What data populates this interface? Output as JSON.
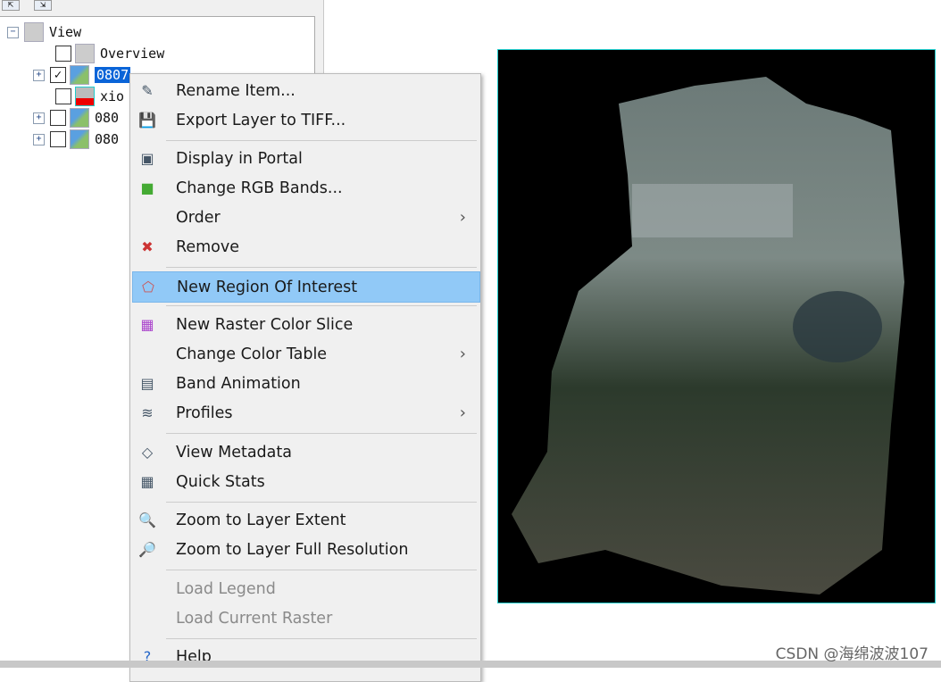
{
  "tree": {
    "root": "View",
    "nodes": [
      {
        "label": "Overview",
        "checked": false,
        "icon": "eye-monitor-icon"
      },
      {
        "label": "0807",
        "checked": true,
        "icon": "raster-icon",
        "selected": true
      },
      {
        "label": "xio",
        "checked": false,
        "icon": "roi-layer-icon"
      },
      {
        "label": "080",
        "checked": false,
        "icon": "raster-icon"
      },
      {
        "label": "080",
        "checked": false,
        "icon": "raster-icon"
      }
    ]
  },
  "menu": {
    "items": [
      {
        "label": "Rename Item...",
        "icon": "rename-icon"
      },
      {
        "label": "Export Layer to TIFF...",
        "icon": "save-icon"
      },
      {
        "label": "Display in Portal",
        "icon": "portal-icon"
      },
      {
        "label": "Change RGB Bands...",
        "icon": "rgb-icon"
      },
      {
        "label": "Order",
        "icon": "",
        "submenu": true
      },
      {
        "label": "Remove",
        "icon": "remove-icon"
      },
      {
        "label": "New Region Of Interest",
        "icon": "roi-icon",
        "highlighted": true
      },
      {
        "label": "New Raster Color Slice",
        "icon": "color-slice-icon"
      },
      {
        "label": "Change Color Table",
        "icon": "",
        "submenu": true
      },
      {
        "label": "Band Animation",
        "icon": "animation-icon"
      },
      {
        "label": "Profiles",
        "icon": "profiles-icon",
        "submenu": true
      },
      {
        "label": "View Metadata",
        "icon": "tag-icon"
      },
      {
        "label": "Quick Stats",
        "icon": "calculator-icon"
      },
      {
        "label": "Zoom to Layer Extent",
        "icon": "zoom-extent-icon"
      },
      {
        "label": "Zoom to Layer Full Resolution",
        "icon": "zoom-full-icon"
      },
      {
        "label": "Load Legend",
        "icon": "",
        "disabled": true
      },
      {
        "label": "Load Current Raster",
        "icon": "",
        "disabled": true
      },
      {
        "label": "Help",
        "icon": "help-icon"
      }
    ]
  },
  "watermark": "CSDN @海绵波波107",
  "colors": {
    "highlight": "#91c9f7",
    "selection": "#0a64d8",
    "arrow": "#e8382f",
    "canvas_border": "#22cccc"
  }
}
